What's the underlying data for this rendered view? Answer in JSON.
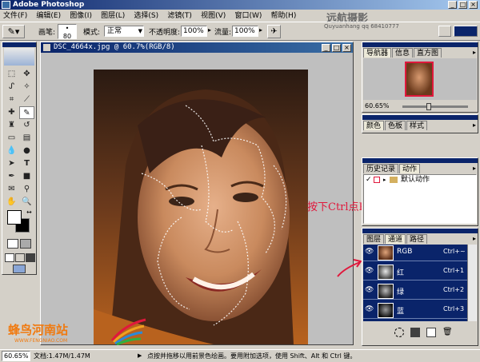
{
  "app": {
    "title": "Adobe Photoshop"
  },
  "menu": [
    "文件(F)",
    "编辑(E)",
    "图像(I)",
    "图层(L)",
    "选择(S)",
    "滤镜(T)",
    "视图(V)",
    "窗口(W)",
    "帮助(H)"
  ],
  "watermark": {
    "text": "远航摄影",
    "subtext": "Quyuanhang qq 68410777"
  },
  "options": {
    "brush_label": "画笔:",
    "brush_size": "80",
    "mode_label": "模式:",
    "mode_value": "正常",
    "opacity_label": "不透明度:",
    "opacity_value": "100%",
    "flow_label": "流量:",
    "flow_value": "100%"
  },
  "document": {
    "title": "DSC_4664x.jpg @ 60.7%(RGB/8)"
  },
  "annotation": {
    "text": "按下Ctrl点RGB通道"
  },
  "navigator": {
    "tabs": [
      "导航器",
      "信息",
      "直方图"
    ],
    "zoom": "60.65%"
  },
  "color_panel": {
    "tabs": [
      "颜色",
      "色板",
      "样式"
    ]
  },
  "history_panel": {
    "tabs": [
      "历史记录",
      "动作"
    ],
    "item": "默认动作"
  },
  "channels_panel": {
    "tabs": [
      "图层",
      "通道",
      "路径"
    ],
    "channels": [
      {
        "name": "RGB",
        "shortcut": "Ctrl+~"
      },
      {
        "name": "红",
        "shortcut": "Ctrl+1"
      },
      {
        "name": "绿",
        "shortcut": "Ctrl+2"
      },
      {
        "name": "蓝",
        "shortcut": "Ctrl+3"
      }
    ]
  },
  "logo": {
    "text": "蜂鸟河南站",
    "url_text": "WWW.FENGNIAO.COM"
  },
  "status": {
    "zoom": "60.65%",
    "doc": "文档:1.47M/1.47M",
    "hint": "点按并拖移以用前景色绘画。要用附加选项，使用 Shift、Alt 和 Ctrl 键。"
  },
  "colors": {
    "titlebar": "#0a246a",
    "annotation": "#e0183c",
    "logo": "#f07a10"
  }
}
